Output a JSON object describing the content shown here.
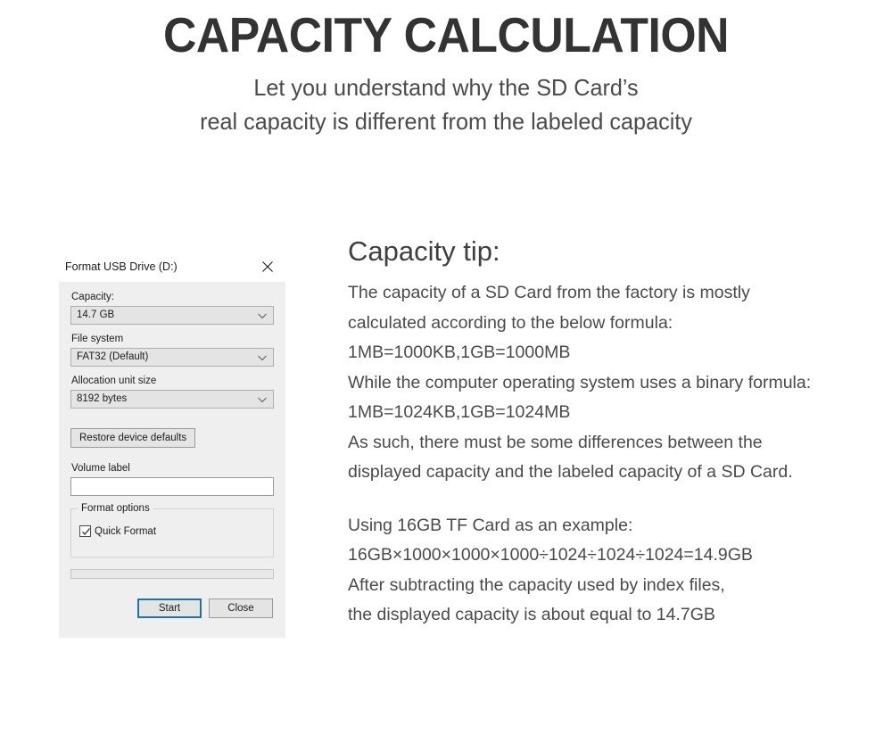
{
  "header": {
    "title": "CAPACITY CALCULATION",
    "subtitle_line1": "Let you understand why the SD Card’s",
    "subtitle_line2": "real capacity is different from the labeled capacity"
  },
  "dialog": {
    "title": "Format USB Drive (D:)",
    "close_icon": "close-icon",
    "capacity": {
      "label": "Capacity:",
      "value": "14.7 GB",
      "arrow_icon": "chevron-down-icon"
    },
    "file_system": {
      "label": "File system",
      "value": "FAT32 (Default)",
      "arrow_icon": "chevron-down-icon"
    },
    "allocation_unit_size": {
      "label": "Allocation unit size",
      "value": "8192 bytes",
      "arrow_icon": "chevron-down-icon"
    },
    "restore_defaults_label": "Restore device defaults",
    "volume_label": {
      "label": "Volume label",
      "value": "",
      "placeholder": ""
    },
    "format_options": {
      "legend": "Format options",
      "quick_format_label": "Quick Format",
      "quick_format_checked": true,
      "check_icon": "checkmark-icon"
    },
    "progress": {
      "percent": 0
    },
    "buttons": {
      "start": "Start",
      "close": "Close"
    },
    "colors": {
      "focus_ring": "#1a74ad",
      "body_background": "#efeff0",
      "control_background": "#e4e4e4"
    }
  },
  "tip": {
    "heading": "Capacity tip:",
    "body_block_1": [
      "The capacity of a SD Card from the factory is mostly",
      "calculated according to the below formula:",
      "1MB=1000KB,1GB=1000MB",
      "While the computer operating system uses a binary formula:",
      "1MB=1024KB,1GB=1024MB",
      "As such, there must be some differences between the",
      "displayed capacity and the labeled capacity of a SD Card."
    ],
    "body_block_2": [
      "Using 16GB TF Card as an example:",
      "16GB×1000×1000×1000÷1024÷1024÷1024=14.9GB",
      "After subtracting the capacity used by index files,",
      "the displayed capacity is about equal to 14.7GB"
    ]
  }
}
